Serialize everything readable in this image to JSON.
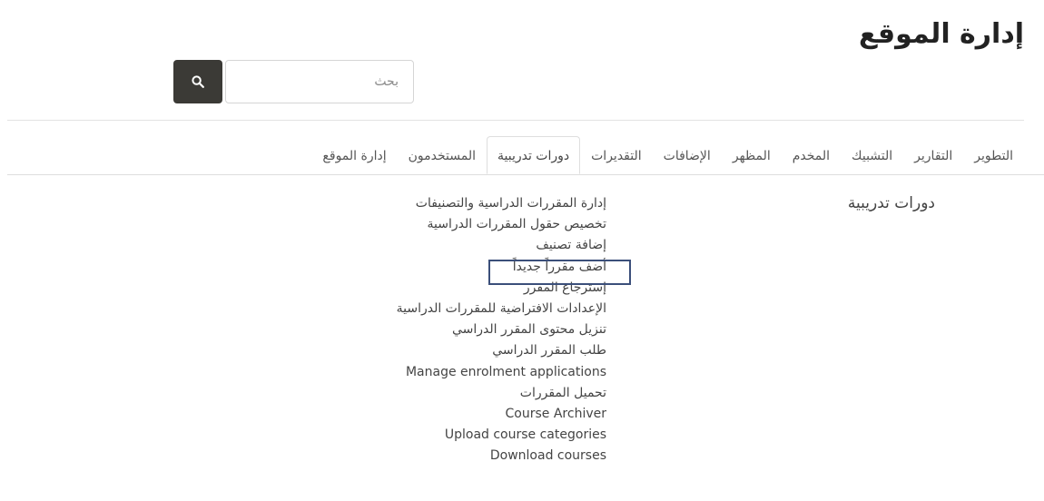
{
  "header": {
    "title": "إدارة الموقع"
  },
  "search": {
    "placeholder": "بحث",
    "button_icon": "search-icon"
  },
  "tabs": [
    {
      "label": "إدارة الموقع"
    },
    {
      "label": "المستخدمون"
    },
    {
      "label": "دورات تدريبية",
      "active": true
    },
    {
      "label": "التقديرات"
    },
    {
      "label": "الإضافات"
    },
    {
      "label": "المظهر"
    },
    {
      "label": "المخدم"
    },
    {
      "label": "التشبيك"
    },
    {
      "label": "التقارير"
    },
    {
      "label": "التطوير"
    }
  ],
  "section": {
    "heading": "دورات تدريبية",
    "links": [
      {
        "label": "إدارة المقررات الدراسية والتصنيفات"
      },
      {
        "label": "تخصيص حقول المقررات الدراسية"
      },
      {
        "label": "إضافة تصنيف"
      },
      {
        "label": "أضف مقرراً جديداً",
        "highlighted": true
      },
      {
        "label": "إسترجاع المقرر"
      },
      {
        "label": "الإعدادات الافتراضية للمقررات الدراسية"
      },
      {
        "label": "تنزيل محتوى المقرر الدراسي"
      },
      {
        "label": "طلب المقرر الدراسي"
      },
      {
        "label": "Manage enrolment applications"
      },
      {
        "label": "تحميل المقررات"
      },
      {
        "label": "Course Archiver"
      },
      {
        "label": "Upload course categories"
      },
      {
        "label": "Download courses"
      }
    ]
  },
  "colors": {
    "search_button": "#3b3a36",
    "highlight_border": "#3b4f7a"
  }
}
